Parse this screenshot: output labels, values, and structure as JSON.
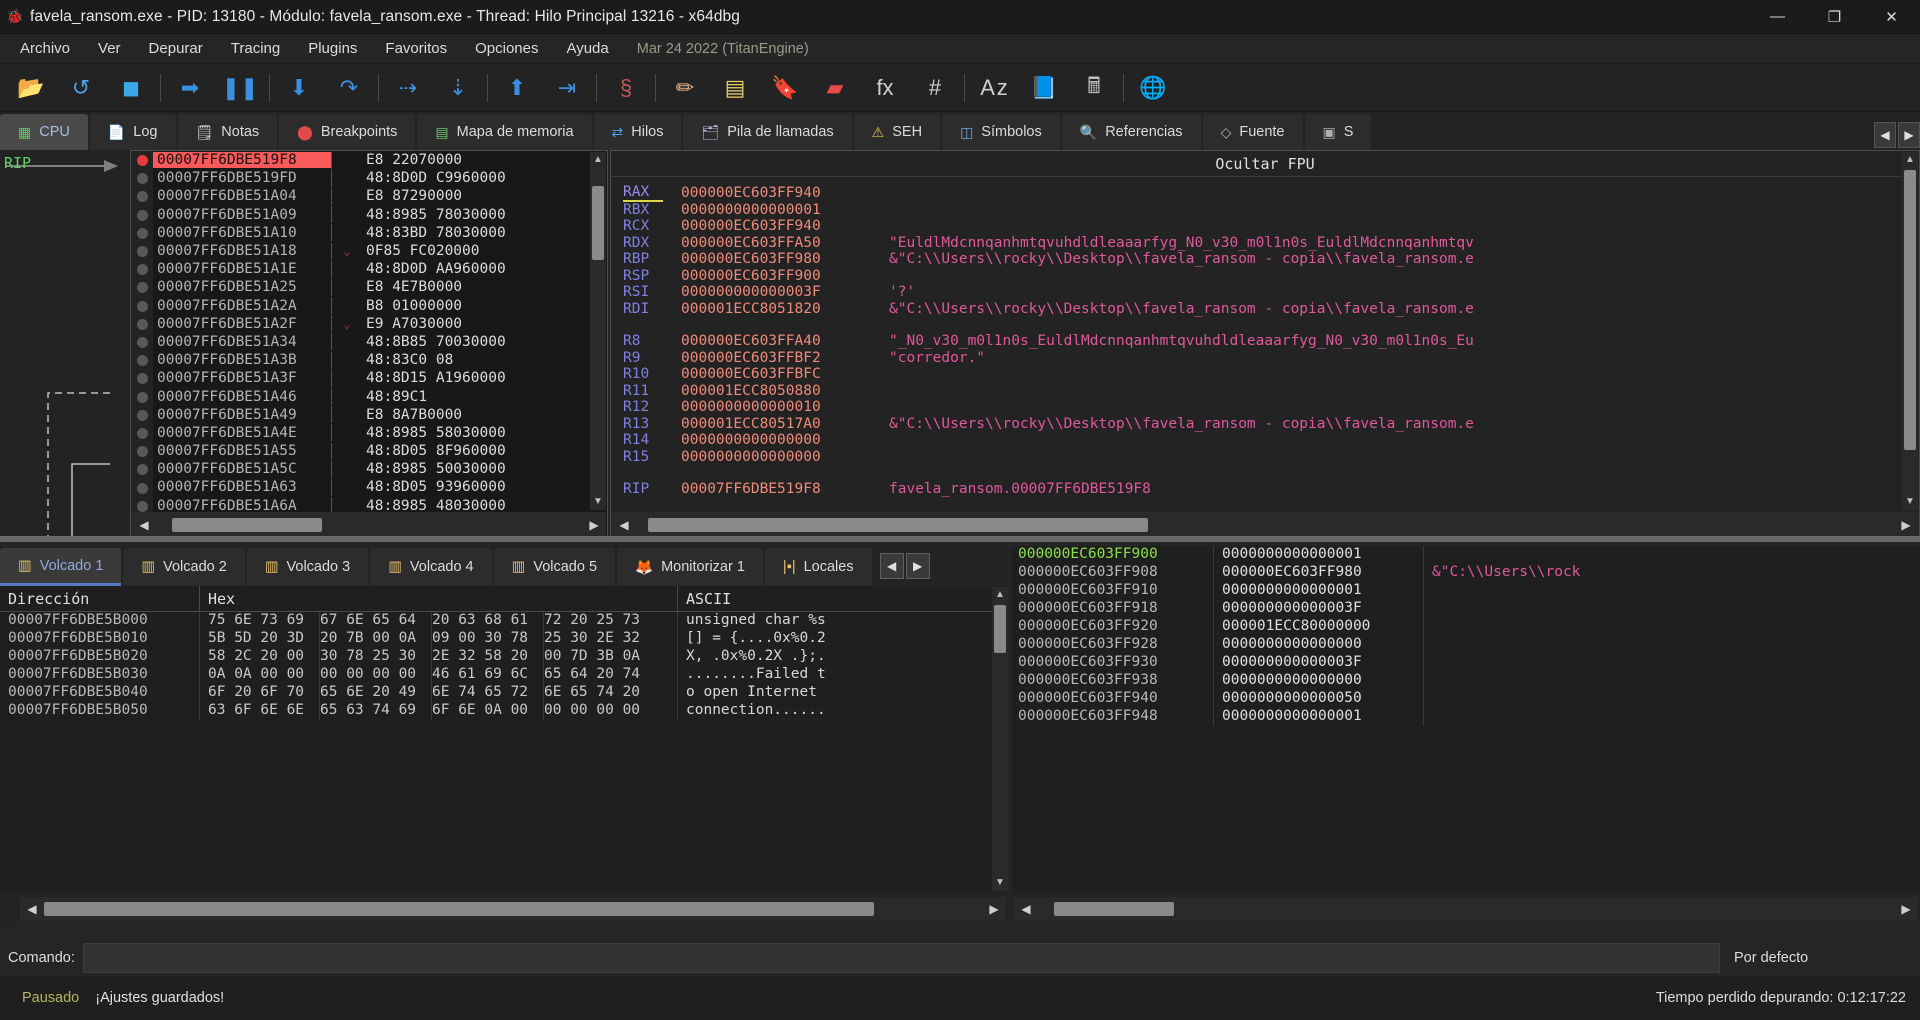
{
  "window": {
    "title": "favela_ransom.exe - PID: 13180 - Módulo: favela_ransom.exe - Thread: Hilo Principal 13216 - x64dbg",
    "icon": "bug-icon",
    "minimize": "—",
    "maximize": "❐",
    "close": "✕"
  },
  "menu": {
    "items": [
      {
        "label": "Archivo"
      },
      {
        "label": "Ver"
      },
      {
        "label": "Depurar"
      },
      {
        "label": "Tracing"
      },
      {
        "label": "Plugins"
      },
      {
        "label": "Favoritos"
      },
      {
        "label": "Opciones"
      },
      {
        "label": "Ayuda"
      }
    ],
    "build": "Mar 24 2022 (TitanEngine)"
  },
  "toolbar": {
    "buttons": [
      {
        "name": "open-icon",
        "glyph": "📂",
        "color": "#e8b44a"
      },
      {
        "name": "restart-icon",
        "glyph": "↺",
        "color": "#4a9fe8"
      },
      {
        "name": "stop-icon",
        "glyph": "◼",
        "color": "#3aa8e8"
      },
      {
        "name": "separator",
        "glyph": "",
        "color": ""
      },
      {
        "name": "run-icon",
        "glyph": "➡",
        "color": "#3a8fe0"
      },
      {
        "name": "pause-icon",
        "glyph": "❚❚",
        "color": "#3a8fe0"
      },
      {
        "name": "separator",
        "glyph": "",
        "color": ""
      },
      {
        "name": "step-into-icon",
        "glyph": "⬇",
        "color": "#3a8fe0"
      },
      {
        "name": "step-over-icon",
        "glyph": "↷",
        "color": "#3a8fe0"
      },
      {
        "name": "separator",
        "glyph": "",
        "color": ""
      },
      {
        "name": "trace-into-icon",
        "glyph": "⇢",
        "color": "#3a8fe0"
      },
      {
        "name": "trace-over-icon",
        "glyph": "⇣",
        "color": "#3a8fe0"
      },
      {
        "name": "separator",
        "glyph": "",
        "color": ""
      },
      {
        "name": "execute-till-return-icon",
        "glyph": "⬆",
        "color": "#3a8fe0"
      },
      {
        "name": "run-to-user-code-icon",
        "glyph": "⇥",
        "color": "#3a8fe0"
      },
      {
        "name": "separator",
        "glyph": "",
        "color": ""
      },
      {
        "name": "scylla-icon",
        "glyph": "§",
        "color": "#c25a5a"
      },
      {
        "name": "separator",
        "glyph": "",
        "color": ""
      },
      {
        "name": "log-icon",
        "glyph": "✏",
        "color": "#e8b88a"
      },
      {
        "name": "notes-icon",
        "glyph": "▤",
        "color": "#e8d070"
      },
      {
        "name": "breakpoints-icon",
        "glyph": "🔖",
        "color": "#5ab0e8"
      },
      {
        "name": "memory-map-icon",
        "glyph": "▰",
        "color": "#e84a4a"
      },
      {
        "name": "functions-icon",
        "glyph": "fx",
        "color": "#d0d0d0"
      },
      {
        "name": "references-icon",
        "glyph": "#",
        "color": "#d0d0d0"
      },
      {
        "name": "separator",
        "glyph": "",
        "color": ""
      },
      {
        "name": "symbols-icon",
        "glyph": "A z",
        "color": "#d0d0d0"
      },
      {
        "name": "source-icon",
        "glyph": "📘",
        "color": "#5a9ae8"
      },
      {
        "name": "calculator-icon",
        "glyph": "🖩",
        "color": "#c0c0c0"
      },
      {
        "name": "separator",
        "glyph": "",
        "color": ""
      },
      {
        "name": "globe-icon",
        "glyph": "🌐",
        "color": "#4a9fe8"
      }
    ]
  },
  "main_tabs": [
    {
      "label": "CPU",
      "icon": "cpu-icon",
      "active": true,
      "glyph": "▦",
      "color": "#6ac46a"
    },
    {
      "label": "Log",
      "icon": "log-icon",
      "active": false,
      "glyph": "📄",
      "color": "#e0e0e0"
    },
    {
      "label": "Notas",
      "icon": "notes-icon",
      "active": false,
      "glyph": "🗒",
      "color": "#e0e0e0"
    },
    {
      "label": "Breakpoints",
      "icon": "breakpoint-icon",
      "active": false,
      "glyph": "⬤",
      "color": "#e04a4a"
    },
    {
      "label": "Mapa de memoria",
      "icon": "memory-map-icon",
      "active": false,
      "glyph": "▤",
      "color": "#6ac46a"
    },
    {
      "label": "Hilos",
      "icon": "threads-icon",
      "active": false,
      "glyph": "⇄",
      "color": "#4a9fe8"
    },
    {
      "label": "Pila de llamadas",
      "icon": "call-stack-icon",
      "active": false,
      "glyph": "🗂",
      "color": "#b8b8e8"
    },
    {
      "label": "SEH",
      "icon": "seh-icon",
      "active": false,
      "glyph": "⚠",
      "color": "#e8c04a"
    },
    {
      "label": "Símbolos",
      "icon": "symbols-icon",
      "active": false,
      "glyph": "◫",
      "color": "#6aa8e8"
    },
    {
      "label": "Referencias",
      "icon": "references-icon",
      "active": false,
      "glyph": "🔍",
      "color": "#9ab8d8"
    },
    {
      "label": "Fuente",
      "icon": "source-icon",
      "active": false,
      "glyph": "◇",
      "color": "#b0b0b0"
    },
    {
      "label": "S",
      "icon": "more-icon",
      "active": false,
      "glyph": "▣",
      "color": "#b0b0b0"
    }
  ],
  "tab_nav": {
    "prev": "◀",
    "next": "▶"
  },
  "cpu": {
    "rip_label": "RIP",
    "disassembly": [
      {
        "addr": "00007FF6DBE519F8",
        "bytes": "E8 22070000",
        "current": true,
        "bp": true,
        "arrow": ""
      },
      {
        "addr": "00007FF6DBE519FD",
        "bytes": "48:8D0D C9960000",
        "current": false,
        "bp": false,
        "arrow": ""
      },
      {
        "addr": "00007FF6DBE51A04",
        "bytes": "E8 87290000",
        "current": false,
        "bp": false,
        "arrow": ""
      },
      {
        "addr": "00007FF6DBE51A09",
        "bytes": "48:8985 78030000",
        "current": false,
        "bp": false,
        "arrow": ""
      },
      {
        "addr": "00007FF6DBE51A10",
        "bytes": "48:83BD 78030000",
        "current": false,
        "bp": false,
        "arrow": ""
      },
      {
        "addr": "00007FF6DBE51A18",
        "bytes": "0F85 FC020000",
        "current": false,
        "bp": false,
        "arrow": "⌄"
      },
      {
        "addr": "00007FF6DBE51A1E",
        "bytes": "48:8D0D AA960000",
        "current": false,
        "bp": false,
        "arrow": ""
      },
      {
        "addr": "00007FF6DBE51A25",
        "bytes": "E8 4E7B0000",
        "current": false,
        "bp": false,
        "arrow": ""
      },
      {
        "addr": "00007FF6DBE51A2A",
        "bytes": "B8 01000000",
        "current": false,
        "bp": false,
        "arrow": ""
      },
      {
        "addr": "00007FF6DBE51A2F",
        "bytes": "E9 A7030000",
        "current": false,
        "bp": false,
        "arrow": "⌄"
      },
      {
        "addr": "00007FF6DBE51A34",
        "bytes": "48:8B85 70030000",
        "current": false,
        "bp": false,
        "arrow": ""
      },
      {
        "addr": "00007FF6DBE51A3B",
        "bytes": "48:83C0 08",
        "current": false,
        "bp": false,
        "arrow": ""
      },
      {
        "addr": "00007FF6DBE51A3F",
        "bytes": "48:8D15 A1960000",
        "current": false,
        "bp": false,
        "arrow": ""
      },
      {
        "addr": "00007FF6DBE51A46",
        "bytes": "48:89C1",
        "current": false,
        "bp": false,
        "arrow": ""
      },
      {
        "addr": "00007FF6DBE51A49",
        "bytes": "E8 8A7B0000",
        "current": false,
        "bp": false,
        "arrow": ""
      },
      {
        "addr": "00007FF6DBE51A4E",
        "bytes": "48:8985 58030000",
        "current": false,
        "bp": false,
        "arrow": ""
      },
      {
        "addr": "00007FF6DBE51A55",
        "bytes": "48:8D05 8F960000",
        "current": false,
        "bp": false,
        "arrow": ""
      },
      {
        "addr": "00007FF6DBE51A5C",
        "bytes": "48:8985 50030000",
        "current": false,
        "bp": false,
        "arrow": ""
      },
      {
        "addr": "00007FF6DBE51A63",
        "bytes": "48:8D05 93960000",
        "current": false,
        "bp": false,
        "arrow": ""
      },
      {
        "addr": "00007FF6DBE51A6A",
        "bytes": "48:8985 48030000",
        "current": false,
        "bp": false,
        "arrow": ""
      }
    ],
    "fpu_toggle": "Ocultar FPU",
    "registers": [
      {
        "name": "RAX",
        "value": "000000EC603FF940",
        "comment": "",
        "highlight": true
      },
      {
        "name": "RBX",
        "value": "0000000000000001",
        "comment": "",
        "highlight": false
      },
      {
        "name": "RCX",
        "value": "000000EC603FF940",
        "comment": "",
        "highlight": false
      },
      {
        "name": "RDX",
        "value": "000000EC603FFA50",
        "comment": "\"EuldlMdcnnqanhmtqvuhdldleaaarfyg_N0_v30_m0l1n0s_EuldlMdcnnqanhmtqv",
        "highlight": false
      },
      {
        "name": "RBP",
        "value": "000000EC603FF980",
        "comment": "&\"C:\\\\Users\\\\rocky\\\\Desktop\\\\favela_ransom - copia\\\\favela_ransom.e",
        "highlight": false
      },
      {
        "name": "RSP",
        "value": "000000EC603FF900",
        "comment": "",
        "highlight": false
      },
      {
        "name": "RSI",
        "value": "000000000000003F",
        "comment": "'?'",
        "highlight": false
      },
      {
        "name": "RDI",
        "value": "000001ECC8051820",
        "comment": "&\"C:\\\\Users\\\\rocky\\\\Desktop\\\\favela_ransom - copia\\\\favela_ransom.e",
        "highlight": false
      },
      {
        "name": "",
        "value": "",
        "comment": "",
        "highlight": false
      },
      {
        "name": "R8",
        "value": "000000EC603FFA40",
        "comment": "\"_N0_v30_m0l1n0s_EuldlMdcnnqanhmtqvuhdldleaaarfyg_N0_v30_m0l1n0s_Eu",
        "highlight": false
      },
      {
        "name": "R9",
        "value": "000000EC603FFBF2",
        "comment": "\"corredor.\"",
        "highlight": false
      },
      {
        "name": "R10",
        "value": "000000EC603FFBFC",
        "comment": "",
        "highlight": false
      },
      {
        "name": "R11",
        "value": "000001ECC8050880",
        "comment": "",
        "highlight": false
      },
      {
        "name": "R12",
        "value": "0000000000000010",
        "comment": "",
        "highlight": false
      },
      {
        "name": "R13",
        "value": "000001ECC80517A0",
        "comment": "&\"C:\\\\Users\\\\rocky\\\\Desktop\\\\favela_ransom - copia\\\\favela_ransom.e",
        "highlight": false
      },
      {
        "name": "R14",
        "value": "0000000000000000",
        "comment": "",
        "highlight": false
      },
      {
        "name": "R15",
        "value": "0000000000000000",
        "comment": "",
        "highlight": false
      },
      {
        "name": "",
        "value": "",
        "comment": "",
        "highlight": false
      },
      {
        "name": "RIP",
        "value": "00007FF6DBE519F8",
        "comment": "favela_ransom.00007FF6DBE519F8",
        "highlight": false
      }
    ]
  },
  "dump": {
    "tabs": [
      {
        "label": "Volcado 1",
        "icon": "dump-icon",
        "active": true
      },
      {
        "label": "Volcado 2",
        "icon": "dump-icon",
        "active": false
      },
      {
        "label": "Volcado 3",
        "icon": "dump-icon",
        "active": false
      },
      {
        "label": "Volcado 4",
        "icon": "dump-icon",
        "active": false
      },
      {
        "label": "Volcado 5",
        "icon": "dump-icon",
        "active": false
      },
      {
        "label": "Monitorizar 1",
        "icon": "watch-icon",
        "active": false
      },
      {
        "label": "Locales",
        "icon": "locals-icon",
        "active": false
      }
    ],
    "nav": {
      "prev": "◀",
      "next": "▶"
    },
    "headers": {
      "address": "Dirección",
      "hex": "Hex",
      "ascii": "ASCII"
    },
    "rows": [
      {
        "addr": "00007FF6DBE5B000",
        "hex": [
          "75 6E 73 69",
          "67 6E 65 64",
          "20 63 68 61",
          "72 20 25 73"
        ],
        "ascii": "unsigned char %s"
      },
      {
        "addr": "00007FF6DBE5B010",
        "hex": [
          "5B 5D 20 3D",
          "20 7B 00 0A",
          "09 00 30 78",
          "25 30 2E 32"
        ],
        "ascii": "[] = {....0x%0.2"
      },
      {
        "addr": "00007FF6DBE5B020",
        "hex": [
          "58 2C 20 00",
          "30 78 25 30",
          "2E 32 58 20",
          "00 7D 3B 0A"
        ],
        "ascii": "X, .0x%0.2X .};."
      },
      {
        "addr": "00007FF6DBE5B030",
        "hex": [
          "0A 0A 00 00",
          "00 00 00 00",
          "46 61 69 6C",
          "65 64 20 74"
        ],
        "ascii": "........Failed t"
      },
      {
        "addr": "00007FF6DBE5B040",
        "hex": [
          "6F 20 6F 70",
          "65 6E 20 49",
          "6E 74 65 72",
          "6E 65 74 20"
        ],
        "ascii": "o open Internet "
      },
      {
        "addr": "00007FF6DBE5B050",
        "hex": [
          "63 6F 6E 6E",
          "65 63 74 69",
          "6F 6E 0A 00",
          "00 00 00 00"
        ],
        "ascii": "connection......"
      }
    ]
  },
  "stack": {
    "rows": [
      {
        "addr": "000000EC603FF900",
        "value": "0000000000000001",
        "comment": "",
        "top": true
      },
      {
        "addr": "000000EC603FF908",
        "value": "000000EC603FF980",
        "comment": "&\"C:\\\\Users\\\\rock",
        "top": false
      },
      {
        "addr": "000000EC603FF910",
        "value": "0000000000000001",
        "comment": "",
        "top": false
      },
      {
        "addr": "000000EC603FF918",
        "value": "000000000000003F",
        "comment": "",
        "top": false
      },
      {
        "addr": "000000EC603FF920",
        "value": "000001ECC80000000",
        "comment": "",
        "top": false
      },
      {
        "addr": "000000EC603FF928",
        "value": "0000000000000000",
        "comment": "",
        "top": false
      },
      {
        "addr": "000000EC603FF930",
        "value": "000000000000003F",
        "comment": "",
        "top": false
      },
      {
        "addr": "000000EC603FF938",
        "value": "0000000000000000",
        "comment": "",
        "top": false
      },
      {
        "addr": "000000EC603FF940",
        "value": "0000000000000050",
        "comment": "",
        "top": false
      },
      {
        "addr": "000000EC603FF948",
        "value": "0000000000000001",
        "comment": "",
        "top": false
      }
    ]
  },
  "command": {
    "label": "Comando:",
    "value": "",
    "placeholder": "",
    "mode": "Por defecto"
  },
  "status": {
    "state": "Pausado",
    "message": "¡Ajustes guardados!",
    "time": "Tiempo perdido depurando: 0:12:17:22"
  }
}
